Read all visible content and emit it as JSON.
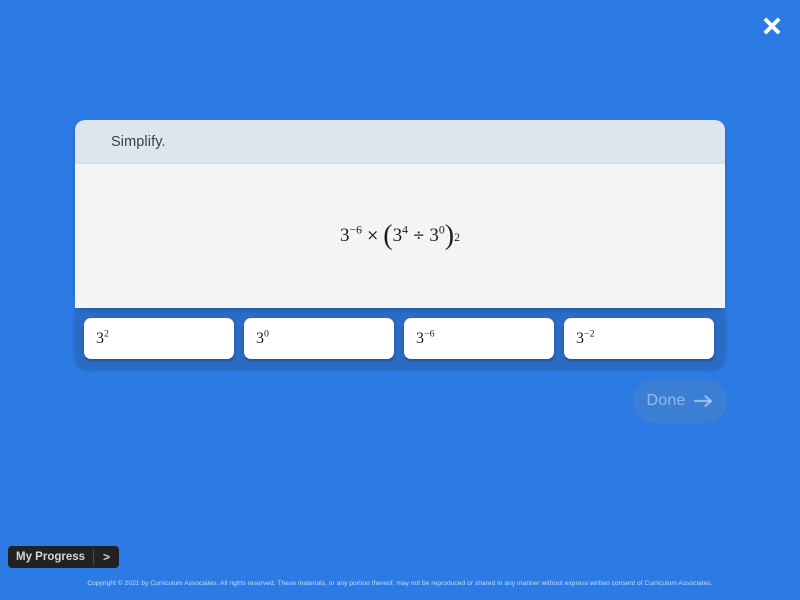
{
  "page": {
    "background_color": "#2c7be5",
    "tray_color": "#2a6cc4"
  },
  "close_button": {
    "label": "Close",
    "icon": "close-icon"
  },
  "card": {
    "prompt": "Simplify.",
    "expression_plain": "3^-6 × (3^4 ÷ 3^0)^2",
    "expression": {
      "base1": "3",
      "exp1": "−6",
      "times": "×",
      "open_paren": "(",
      "base2": "3",
      "exp2": "4",
      "divide": "÷",
      "base3": "3",
      "exp3": "0",
      "close_paren": ")",
      "outer_exp": "2"
    }
  },
  "options": [
    {
      "base": "3",
      "exponent": "2",
      "text": "3^2"
    },
    {
      "base": "3",
      "exponent": "0",
      "text": "3^0"
    },
    {
      "base": "3",
      "exponent": "−6",
      "text": "3^-6"
    },
    {
      "base": "3",
      "exponent": "−2",
      "text": "3^-2"
    }
  ],
  "done_button": {
    "label": "Done",
    "arrow_icon": "arrow-right-icon",
    "enabled": false
  },
  "my_progress": {
    "label": "My Progress",
    "chevron": ">"
  },
  "footer": {
    "copyright": "Copyright © 2021 by Curriculum Associates. All rights reserved. These materials, or any portion thereof, may not be reproduced or shared in any manner without express written consent of Curriculum Associates."
  }
}
